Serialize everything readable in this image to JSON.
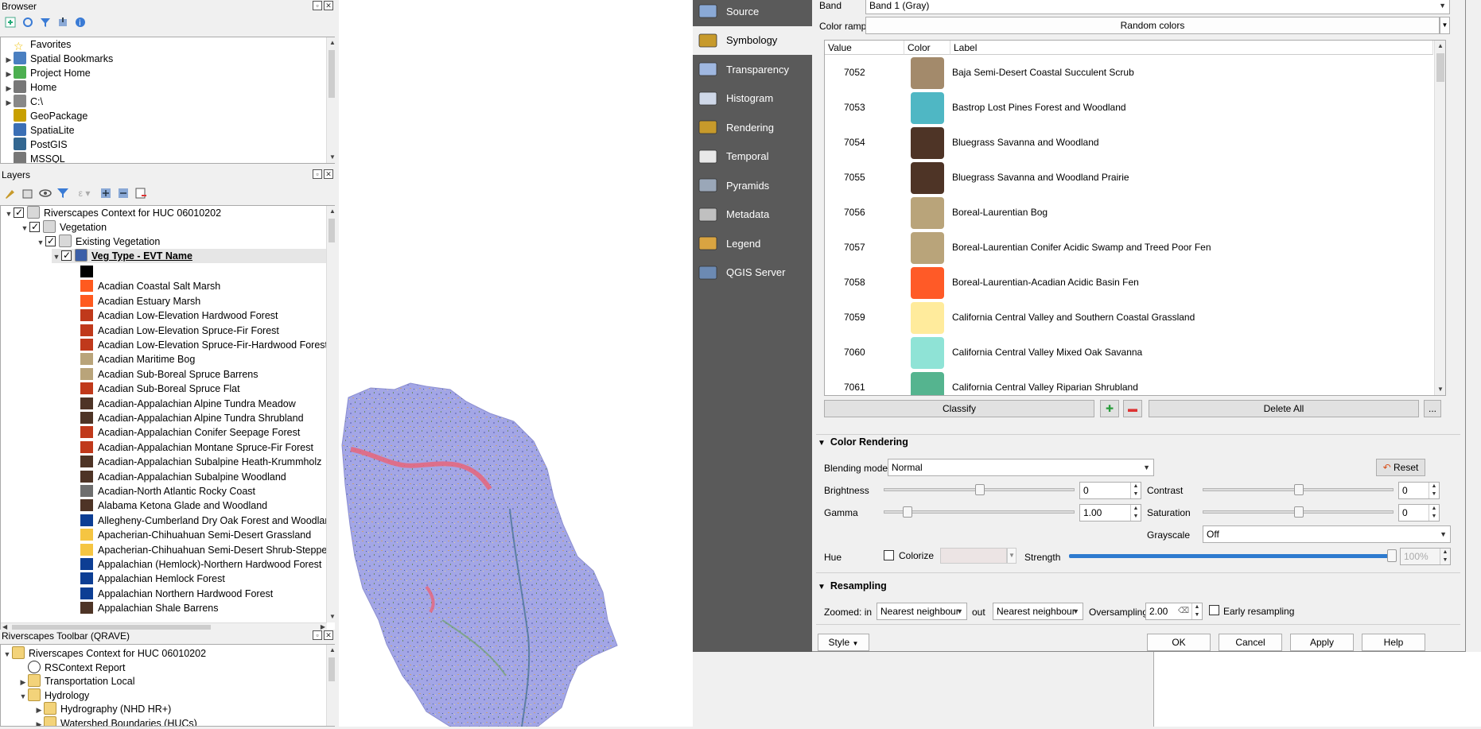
{
  "browser": {
    "title": "Browser",
    "items": [
      {
        "label": "Favorites",
        "icon": "star-icon",
        "color": "#f0c000",
        "arrow": false
      },
      {
        "label": "Spatial Bookmarks",
        "icon": "bookmark-icon",
        "color": "#4a7fc1",
        "arrow": true
      },
      {
        "label": "Project Home",
        "icon": "project-home-icon",
        "color": "#4caf50",
        "arrow": true
      },
      {
        "label": "Home",
        "icon": "home-folder-icon",
        "color": "#777777",
        "arrow": true
      },
      {
        "label": "C:\\",
        "icon": "drive-icon",
        "color": "#888888",
        "arrow": true
      },
      {
        "label": "GeoPackage",
        "icon": "geopackage-icon",
        "color": "#c8a000",
        "arrow": false
      },
      {
        "label": "SpatiaLite",
        "icon": "spatialite-icon",
        "color": "#3b6fb5",
        "arrow": false
      },
      {
        "label": "PostGIS",
        "icon": "postgis-icon",
        "color": "#336791",
        "arrow": false
      },
      {
        "label": "MSSQL",
        "icon": "mssql-icon",
        "color": "#777777",
        "arrow": false
      }
    ]
  },
  "layers": {
    "title": "Layers",
    "tree": [
      {
        "label": "Riverscapes Context for HUC 06010202",
        "indent": 0,
        "bold": false
      },
      {
        "label": "Vegetation",
        "indent": 1,
        "bold": false
      },
      {
        "label": "Existing Vegetation",
        "indent": 2,
        "bold": false
      },
      {
        "label": "Veg Type - EVT Name",
        "indent": 3,
        "bold": true
      }
    ],
    "legend": [
      {
        "label": "",
        "color": "#000000"
      },
      {
        "label": "Acadian Coastal Salt Marsh",
        "color": "#ff5a1f"
      },
      {
        "label": "Acadian Estuary Marsh",
        "color": "#ff5a1f"
      },
      {
        "label": "Acadian Low-Elevation Hardwood Forest",
        "color": "#c0391b"
      },
      {
        "label": "Acadian Low-Elevation Spruce-Fir Forest",
        "color": "#c0391b"
      },
      {
        "label": "Acadian Low-Elevation Spruce-Fir-Hardwood Forest",
        "color": "#c0391b"
      },
      {
        "label": "Acadian Maritime Bog",
        "color": "#b9a47a"
      },
      {
        "label": "Acadian Sub-Boreal Spruce Barrens",
        "color": "#b9a47a"
      },
      {
        "label": "Acadian Sub-Boreal Spruce Flat",
        "color": "#c0391b"
      },
      {
        "label": "Acadian-Appalachian Alpine Tundra Meadow",
        "color": "#4e3426"
      },
      {
        "label": "Acadian-Appalachian Alpine Tundra Shrubland",
        "color": "#4e3426"
      },
      {
        "label": "Acadian-Appalachian Conifer Seepage Forest",
        "color": "#c0391b"
      },
      {
        "label": "Acadian-Appalachian Montane Spruce-Fir Forest",
        "color": "#c0391b"
      },
      {
        "label": "Acadian-Appalachian Subalpine Heath-Krummholz",
        "color": "#4e3426"
      },
      {
        "label": "Acadian-Appalachian Subalpine Woodland",
        "color": "#4e3426"
      },
      {
        "label": "Acadian-North Atlantic Rocky Coast",
        "color": "#6e6e6e"
      },
      {
        "label": "Alabama Ketona Glade and Woodland",
        "color": "#4e3426"
      },
      {
        "label": "Allegheny-Cumberland Dry Oak Forest and Woodland",
        "color": "#0d3e94"
      },
      {
        "label": "Apacherian-Chihuahuan Semi-Desert Grassland",
        "color": "#f5c542"
      },
      {
        "label": "Apacherian-Chihuahuan Semi-Desert Shrub-Steppe",
        "color": "#f5c542"
      },
      {
        "label": "Appalachian (Hemlock)-Northern Hardwood Forest",
        "color": "#0d3e94"
      },
      {
        "label": "Appalachian Hemlock Forest",
        "color": "#0d3e94"
      },
      {
        "label": "Appalachian Northern Hardwood Forest",
        "color": "#0d3e94"
      },
      {
        "label": "Appalachian Shale Barrens",
        "color": "#4e3426"
      }
    ]
  },
  "qrave": {
    "title": "Riverscapes Toolbar (QRAVE)",
    "items": [
      {
        "label": "Riverscapes Context for HUC 06010202",
        "indent": 0,
        "arrow": "down",
        "icon": "folder-icon"
      },
      {
        "label": "RSContext Report",
        "indent": 1,
        "arrow": "",
        "icon": "report-icon"
      },
      {
        "label": "Transportation Local",
        "indent": 1,
        "arrow": "right",
        "icon": "folder-icon"
      },
      {
        "label": "Hydrology",
        "indent": 1,
        "arrow": "down",
        "icon": "folder-icon"
      },
      {
        "label": "Hydrography (NHD HR+)",
        "indent": 2,
        "arrow": "right",
        "icon": "folder-icon"
      },
      {
        "label": "Watershed Boundaries (HUCs)",
        "indent": 2,
        "arrow": "right",
        "icon": "folder-icon"
      }
    ]
  },
  "nav": {
    "items": [
      {
        "label": "Source",
        "icon": "source-icon",
        "active": false
      },
      {
        "label": "Symbology",
        "icon": "symbology-icon",
        "active": true
      },
      {
        "label": "Transparency",
        "icon": "transparency-icon",
        "active": false
      },
      {
        "label": "Histogram",
        "icon": "histogram-icon",
        "active": false
      },
      {
        "label": "Rendering",
        "icon": "rendering-icon",
        "active": false
      },
      {
        "label": "Temporal",
        "icon": "temporal-icon",
        "active": false
      },
      {
        "label": "Pyramids",
        "icon": "pyramids-icon",
        "active": false
      },
      {
        "label": "Metadata",
        "icon": "metadata-icon",
        "active": false
      },
      {
        "label": "Legend",
        "icon": "legend-icon",
        "active": false
      },
      {
        "label": "QGIS Server",
        "icon": "qgis-server-icon",
        "active": false
      }
    ]
  },
  "symbology": {
    "band_label": "Band",
    "band_value": "Band 1 (Gray)",
    "color_ramp_label": "Color ramp",
    "color_ramp_value": "Random colors",
    "columns": [
      "Value",
      "Color",
      "Label"
    ],
    "rows": [
      {
        "value": "7052",
        "color": "#a38a6b",
        "label": "Baja Semi-Desert Coastal Succulent Scrub"
      },
      {
        "value": "7053",
        "color": "#4fb7c4",
        "label": "Bastrop Lost Pines Forest and Woodland"
      },
      {
        "value": "7054",
        "color": "#4e3426",
        "label": "Bluegrass Savanna and Woodland"
      },
      {
        "value": "7055",
        "color": "#4e3426",
        "label": "Bluegrass Savanna and Woodland Prairie"
      },
      {
        "value": "7056",
        "color": "#b9a47a",
        "label": "Boreal-Laurentian Bog"
      },
      {
        "value": "7057",
        "color": "#b9a47a",
        "label": "Boreal-Laurentian Conifer Acidic Swamp and Treed Poor Fen"
      },
      {
        "value": "7058",
        "color": "#ff5a27",
        "label": "Boreal-Laurentian-Acadian Acidic Basin Fen"
      },
      {
        "value": "7059",
        "color": "#ffeb9c",
        "label": "California Central Valley and Southern Coastal Grassland"
      },
      {
        "value": "7060",
        "color": "#8fe3d6",
        "label": "California Central Valley Mixed Oak Savanna"
      },
      {
        "value": "7061",
        "color": "#55b48f",
        "label": "California Central Valley Riparian Shrubland"
      }
    ],
    "classify_label": "Classify",
    "delete_all_label": "Delete All",
    "more_label": "..."
  },
  "color_rendering": {
    "title": "Color Rendering",
    "blending_label": "Blending mode",
    "blending_value": "Normal",
    "reset_label": "Reset",
    "brightness_label": "Brightness",
    "brightness_value": "0",
    "brightness_level": 0.5,
    "contrast_label": "Contrast",
    "contrast_value": "0",
    "contrast_level": 0.5,
    "gamma_label": "Gamma",
    "gamma_value": "1.00",
    "gamma_level": 0.1,
    "saturation_label": "Saturation",
    "saturation_value": "0",
    "saturation_level": 0.5,
    "grayscale_label": "Grayscale",
    "grayscale_value": "Off",
    "hue_label": "Hue",
    "colorize_label": "Colorize",
    "strength_label": "Strength",
    "strength_value": "100%",
    "strength_level": 1.0
  },
  "resampling": {
    "title": "Resampling",
    "zoomed_in_label": "Zoomed: in",
    "zoomed_in_value": "Nearest neighbour",
    "out_label": "out",
    "zoomed_out_value": "Nearest neighbour",
    "oversampling_label": "Oversampling",
    "oversampling_value": "2.00",
    "early_label": "Early resampling"
  },
  "footer": {
    "style_label": "Style",
    "ok_label": "OK",
    "cancel_label": "Cancel",
    "apply_label": "Apply",
    "help_label": "Help"
  }
}
